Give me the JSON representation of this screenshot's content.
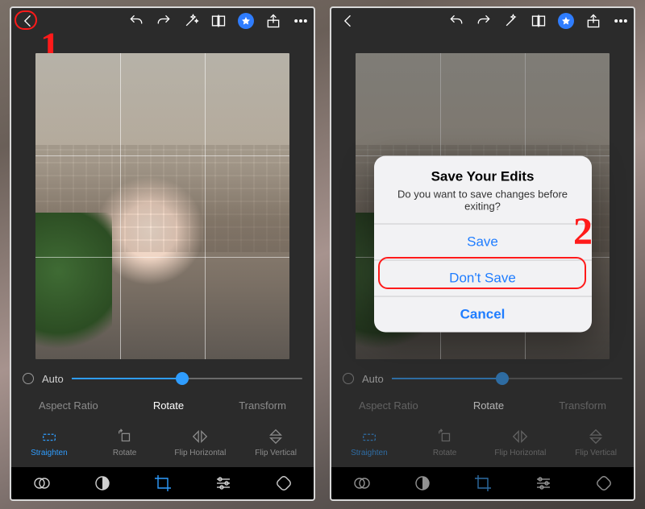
{
  "annotations": {
    "step1": "1",
    "step2": "2"
  },
  "topbar_icons": [
    "back",
    "undo",
    "redo",
    "wand",
    "compare",
    "premium-star",
    "share",
    "more"
  ],
  "slider": {
    "auto_label": "Auto",
    "percent": 48
  },
  "tabs": {
    "aspect": "Aspect Ratio",
    "rotate": "Rotate",
    "transform": "Transform",
    "active": "rotate"
  },
  "tools": {
    "straighten": "Straighten",
    "rotate": "Rotate",
    "flip_h": "Flip Horizontal",
    "flip_v": "Flip Vertical",
    "selected": "straighten"
  },
  "bottom_icons": [
    "light",
    "color",
    "crop",
    "effects",
    "detail"
  ],
  "dialog": {
    "title": "Save Your Edits",
    "message": "Do you want to save changes before exiting?",
    "save": "Save",
    "dont_save": "Don't Save",
    "cancel": "Cancel"
  }
}
